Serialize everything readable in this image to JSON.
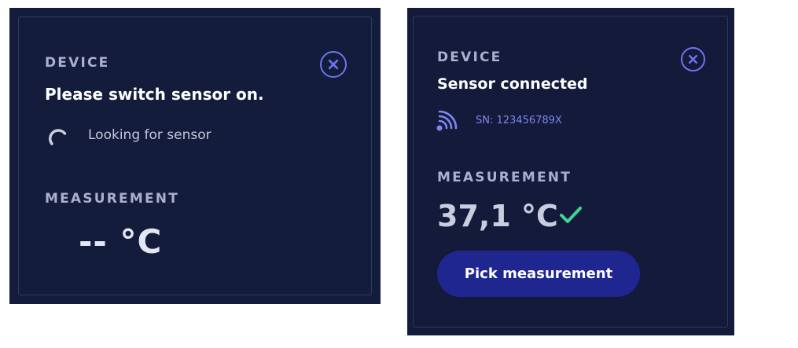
{
  "left_panel": {
    "device_label": "DEVICE",
    "status_title": "Please switch sensor on.",
    "status_message": "Looking for sensor",
    "measurement_label": "MEASUREMENT",
    "temperature": "-- °C",
    "close_icon": "close-circle-icon",
    "spinner_icon": "loading-spinner-icon"
  },
  "right_panel": {
    "device_label": "DEVICE",
    "status_title": "Sensor connected",
    "serial_number": "SN: 123456789X",
    "measurement_label": "MEASUREMENT",
    "temperature": "37,1 °C",
    "pick_button": "Pick measurement",
    "close_icon": "close-circle-icon",
    "signal_icon": "wireless-signal-icon",
    "check_icon": "checkmark-icon"
  },
  "colors": {
    "panel_bg": "#141c3b",
    "accent": "#6e74ee",
    "button_bg": "#1f2690",
    "success": "#3fd39a"
  }
}
